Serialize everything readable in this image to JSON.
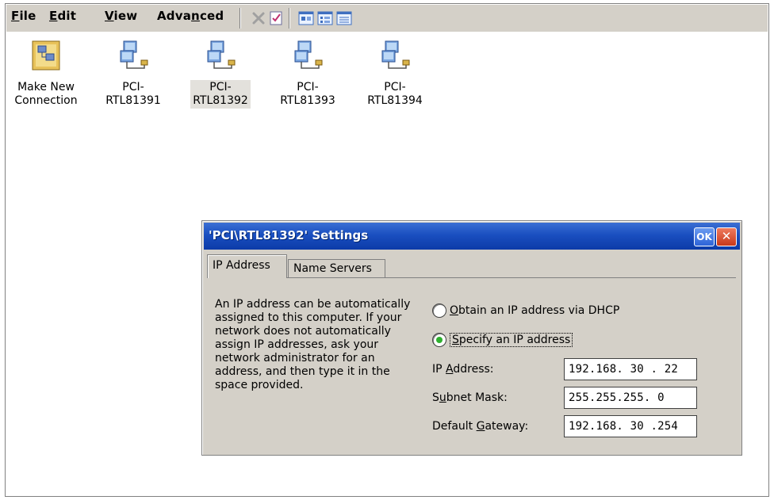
{
  "menu": {
    "file": {
      "pre": "",
      "u": "F",
      "post": "ile"
    },
    "edit": {
      "pre": "",
      "u": "E",
      "post": "dit"
    },
    "view": {
      "pre": "",
      "u": "V",
      "post": "iew"
    },
    "advanced": {
      "pre": "Adva",
      "u": "n",
      "post": "ced"
    }
  },
  "toolbar": {
    "icons": [
      "delete-icon",
      "properties-icon",
      "large-icons-view-icon",
      "small-icons-view-icon",
      "details-view-icon"
    ]
  },
  "desktop": {
    "items": [
      {
        "line1": "Make New",
        "line2": "Connection",
        "icon": "make-new-connection-icon",
        "selected": false
      },
      {
        "line1": "PCI-",
        "line2": "RTL81391",
        "icon": "network-adapter-icon",
        "selected": false
      },
      {
        "line1": "PCI-",
        "line2": "RTL81392",
        "icon": "network-adapter-icon",
        "selected": true
      },
      {
        "line1": "PCI-",
        "line2": "RTL81393",
        "icon": "network-adapter-icon",
        "selected": false
      },
      {
        "line1": "PCI-",
        "line2": "RTL81394",
        "icon": "network-adapter-icon",
        "selected": false
      }
    ]
  },
  "dialog": {
    "title": "'PCI\\RTL81392' Settings",
    "ok_label": "OK",
    "close_label": "✕",
    "tabs": [
      "IP Address",
      "Name Servers"
    ],
    "description": "An IP address can be automatically assigned to this computer.  If your network does not automatically assign IP addresses, ask your network administrator for an address, and then type it in the space provided.",
    "radio_dhcp": {
      "u": "O",
      "post": "btain an IP address via DHCP",
      "selected": false
    },
    "radio_specify": {
      "u": "S",
      "post": "pecify an IP address",
      "selected": true
    },
    "ip": {
      "pre": "IP ",
      "u": "A",
      "post": "ddress:",
      "value": "192.168. 30 . 22"
    },
    "subnet": {
      "pre": "S",
      "u": "u",
      "post": "bnet Mask:",
      "value": "255.255.255. 0"
    },
    "gateway": {
      "pre": "Default ",
      "u": "G",
      "post": "ateway:",
      "value": "192.168. 30 .254"
    }
  },
  "colors": {
    "titlebar": "#1a4fc0",
    "dialog_bg": "#d4d0c8",
    "radio_selected": "#2fb02f",
    "close_button": "#c8381a"
  }
}
